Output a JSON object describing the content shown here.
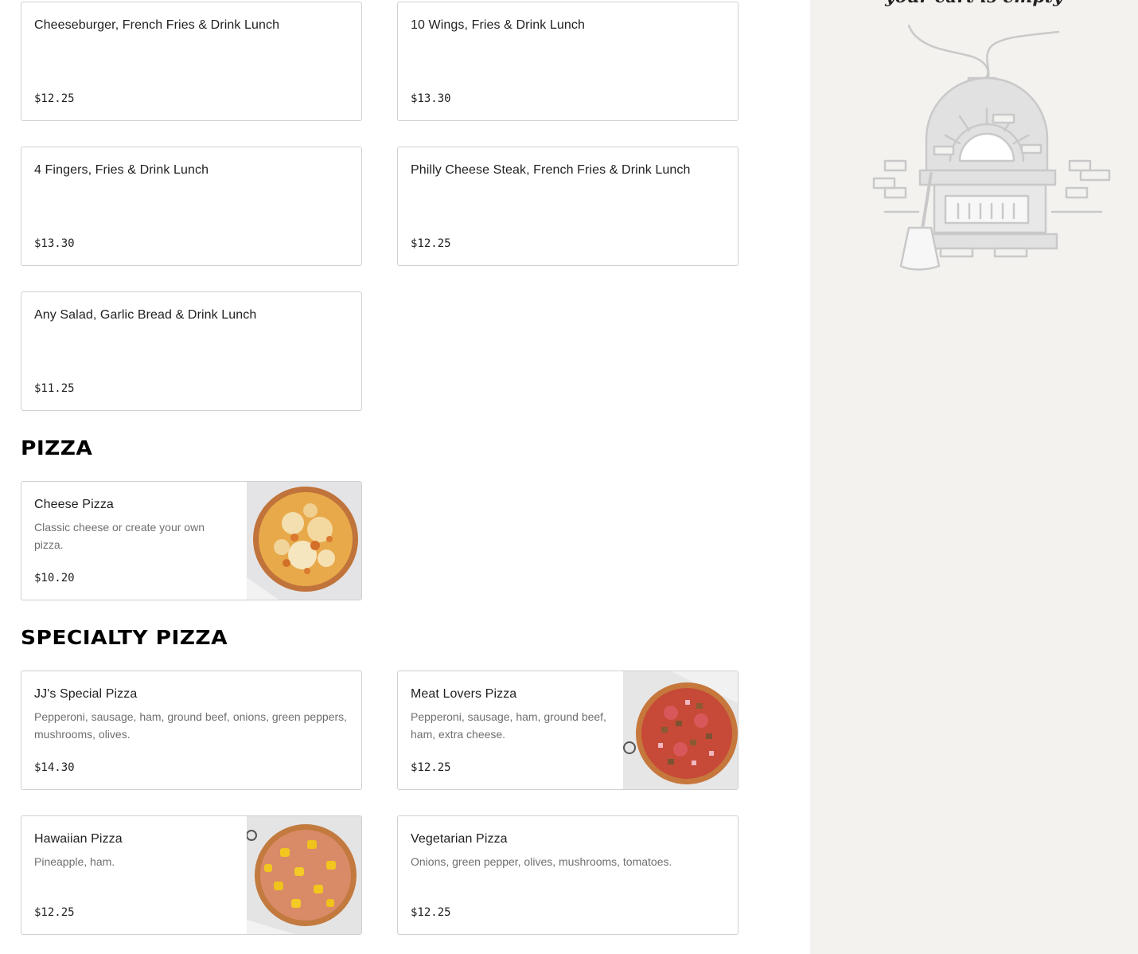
{
  "menu": {
    "lunch_items": [
      {
        "name": "Cheeseburger, French Fries & Drink Lunch",
        "price": "$12.25"
      },
      {
        "name": "10 Wings, Fries & Drink Lunch",
        "price": "$13.30"
      },
      {
        "name": "4 Fingers, Fries & Drink Lunch",
        "price": "$13.30"
      },
      {
        "name": "Philly Cheese Steak, French Fries & Drink Lunch",
        "price": "$12.25"
      },
      {
        "name": "Any Salad, Garlic Bread & Drink Lunch",
        "price": "$11.25"
      }
    ],
    "sections": [
      {
        "title": "PIZZA",
        "items": [
          {
            "name": "Cheese Pizza",
            "description": "Classic cheese or create your own pizza.",
            "price": "$10.20",
            "image": "cheese-pizza-photo"
          }
        ]
      },
      {
        "title": "SPECIALTY PIZZA",
        "items": [
          {
            "name": "JJ's Special Pizza",
            "description": "Pepperoni, sausage, ham, ground beef, onions, green peppers, mushrooms, olives.",
            "price": "$14.30"
          },
          {
            "name": "Meat Lovers Pizza",
            "description": "Pepperoni, sausage, ham, ground beef, ham, extra cheese.",
            "price": "$12.25",
            "image": "meat-lovers-pizza-photo"
          },
          {
            "name": "Hawaiian Pizza",
            "description": "Pineapple, ham.",
            "price": "$12.25",
            "image": "hawaiian-pizza-photo"
          },
          {
            "name": "Vegetarian Pizza",
            "description": "Onions, green pepper, olives, mushrooms, tomatoes.",
            "price": "$12.25"
          }
        ]
      }
    ]
  },
  "cart": {
    "empty_message": "your cart is empty",
    "illustration": "pizza-oven-illustration"
  },
  "colors": {
    "sidebar_bg": "#f3f2ef",
    "card_border": "#d0d0d0",
    "description_text": "#6f6f6f"
  }
}
